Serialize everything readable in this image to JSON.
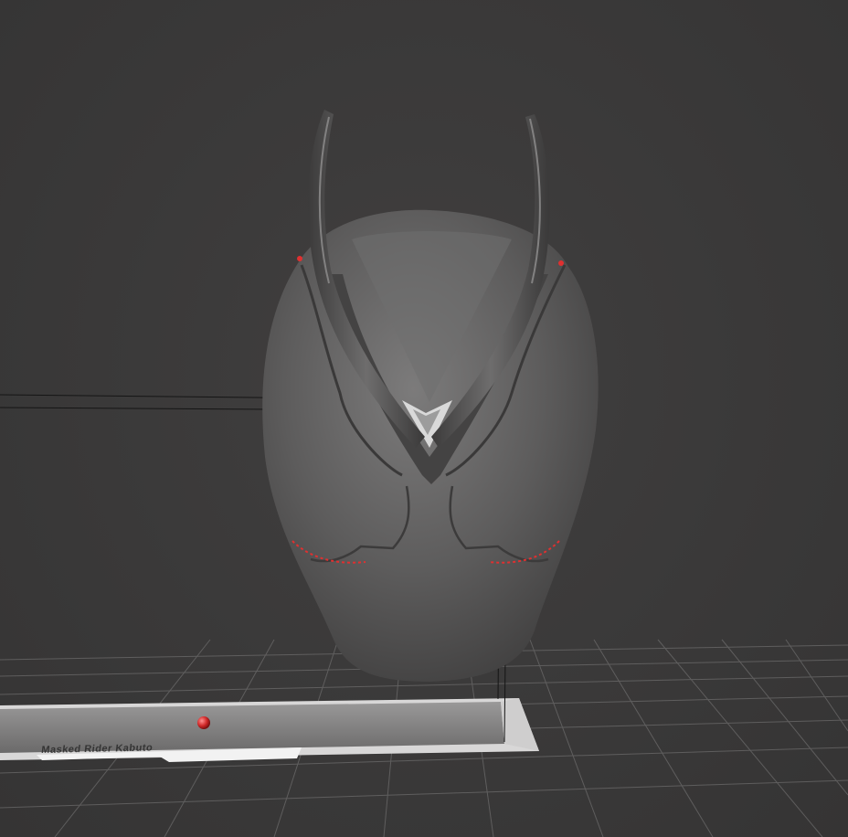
{
  "viewport": {
    "background_color": "#3a3939",
    "model_color": "#6a6a6a",
    "accent_color": "#e03030",
    "grid_color": "#8a8a8a"
  },
  "scene": {
    "objects": [
      {
        "name": "helmet",
        "type": "sculpt-mesh"
      },
      {
        "name": "base-plate",
        "type": "mesh"
      },
      {
        "name": "marker-sphere",
        "type": "mesh"
      }
    ]
  },
  "base_plate": {
    "engraved_text": "Masked Rider Kabuto"
  }
}
